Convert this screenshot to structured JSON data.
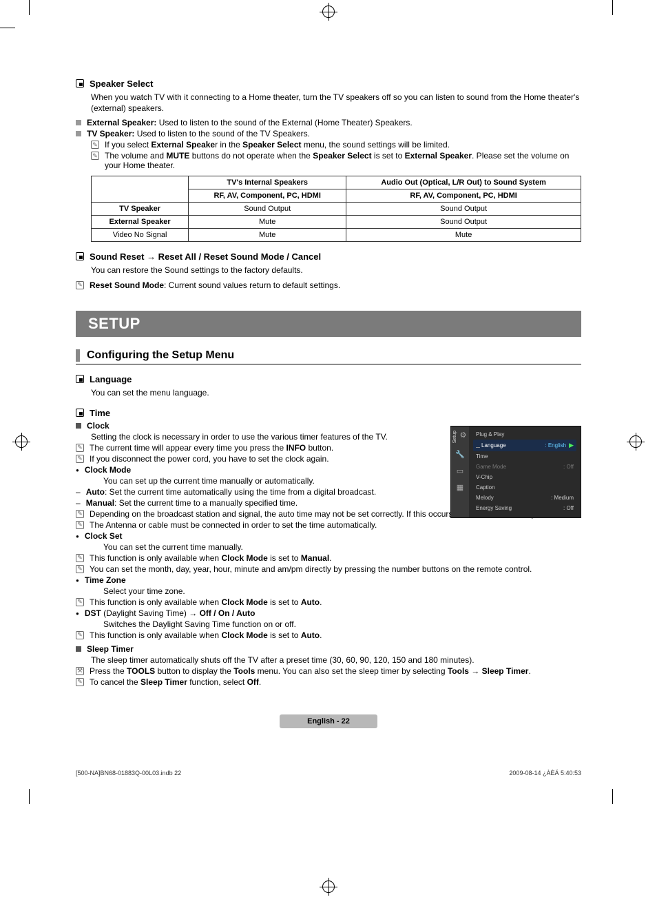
{
  "speaker_select": {
    "title": "Speaker Select",
    "intro": "When you watch TV with it connecting to a Home theater, turn the TV speakers off so you can listen to sound from the Home theater's (external) speakers.",
    "external_label": "External Speaker:",
    "external_text": " Used to listen to the sound of the External (Home Theater) Speakers.",
    "tv_label": "TV Speaker:",
    "tv_text": " Used to listen to the sound of the TV Speakers.",
    "note1_a": "If you select ",
    "note1_b": "External Speake",
    "note1_c": "r in the ",
    "note1_d": "Speaker Select",
    "note1_e": " menu, the sound settings will be limited.",
    "note2_a": "The volume and ",
    "note2_b": "MUTE",
    "note2_c": " buttons do not operate when the ",
    "note2_d": "Speaker Select",
    "note2_e": " is set to ",
    "note2_f": "External Speaker",
    "note2_g": ". Please set the volume on your Home theater."
  },
  "table": {
    "h1": "TV's Internal Speakers",
    "h2": "Audio Out (Optical, L/R Out) to Sound System",
    "sub": "RF, AV, Component, PC, HDMI",
    "rows": {
      "r1": "TV Speaker",
      "r2": "External Speaker",
      "r3": "Video No Signal"
    },
    "cells": {
      "so": "Sound Output",
      "mute": "Mute"
    }
  },
  "sound_reset": {
    "title": "Sound Reset → Reset All / Reset Sound Mode / Cancel",
    "body": "You can restore the Sound settings to the factory defaults.",
    "note_b": "Reset Sound Mode",
    "note_t": ": Current sound values return to default settings."
  },
  "setup_banner": "SETUP",
  "config_title": "Configuring the Setup Menu",
  "language": {
    "title": "Language",
    "body": "You can set the menu language."
  },
  "time": {
    "title": "Time",
    "clock_h": "Clock",
    "clock_intro": "Setting the clock is necessary in order to use the various timer features of the TV.",
    "n1_a": "The current time will appear every time you press the ",
    "n1_b": "INFO",
    "n1_c": " button.",
    "n2": "If you disconnect the power cord, you have to set the clock again.",
    "cm_h": "Clock Mode",
    "cm_body": "You can set up the current time manually or automatically.",
    "cm_auto_b": "Auto",
    "cm_auto_t": ": Set the current time automatically using the time from a digital broadcast.",
    "cm_man_b": "Manual",
    "cm_man_t": ": Set the current time to a manually specified time.",
    "cm_n1": "Depending on the broadcast station and signal, the auto time may not be set correctly. If this occurs, set the time manually.",
    "cm_n2": "The Antenna or cable must be connected in order to set the time automatically.",
    "cs_h": "Clock Set",
    "cs_body": "You can set the current time manually.",
    "cs_n1_a": "This function is only available when ",
    "cs_n1_b": "Clock Mode",
    "cs_n1_c": " is set to ",
    "cs_n1_d": "Manual",
    "cs_n1_e": ".",
    "cs_n2": "You can set the month, day, year, hour, minute and am/pm directly by pressing the number buttons on the remote control.",
    "tz_h": "Time Zone",
    "tz_body": "Select your time zone.",
    "tz_n_a": "This function is only available when ",
    "tz_n_b": "Clock Mode",
    "tz_n_c": " is set to ",
    "tz_n_d": "Auto",
    "tz_n_e": ".",
    "dst_b": "DST",
    "dst_t": " (Daylight Saving Time) → ",
    "dst_opts": "Off / On / Auto",
    "dst_body": "Switches the Daylight Saving Time function on or off.",
    "st_h": "Sleep Timer",
    "st_body": "The sleep timer automatically shuts off the TV after a preset time (30, 60, 90, 120, 150 and 180 minutes).",
    "st_n1_a": "Press the ",
    "st_n1_b": "TOOLS",
    "st_n1_c": " button to display the ",
    "st_n1_d": "Tools",
    "st_n1_e": " menu. You can also set the sleep timer by selecting ",
    "st_n1_f": "Tools",
    "st_n1_g": " → ",
    "st_n1_h": "Sleep Timer",
    "st_n1_i": ".",
    "st_n2_a": "To cancel the ",
    "st_n2_b": "Sleep Timer",
    "st_n2_c": " function, select ",
    "st_n2_d": "Off",
    "st_n2_e": "."
  },
  "osd": {
    "side_label": "Setup",
    "plug": "Plug & Play",
    "lang_l": "Language",
    "lang_v": ": English",
    "time": "Time",
    "game_l": "Game Mode",
    "game_v": ": Off",
    "vchip": "V-Chip",
    "caption": "Caption",
    "mel_l": "Melody",
    "mel_v": ": Medium",
    "es_l": "Energy Saving",
    "es_v": ": Off"
  },
  "footer": {
    "page_b": "English - ",
    "page_n": "22",
    "left_meta": "[500-NA]BN68-01883Q-00L03.indb   22",
    "right_meta": "2009-08-14   ¿ÀÈÄ 5:40:53"
  }
}
